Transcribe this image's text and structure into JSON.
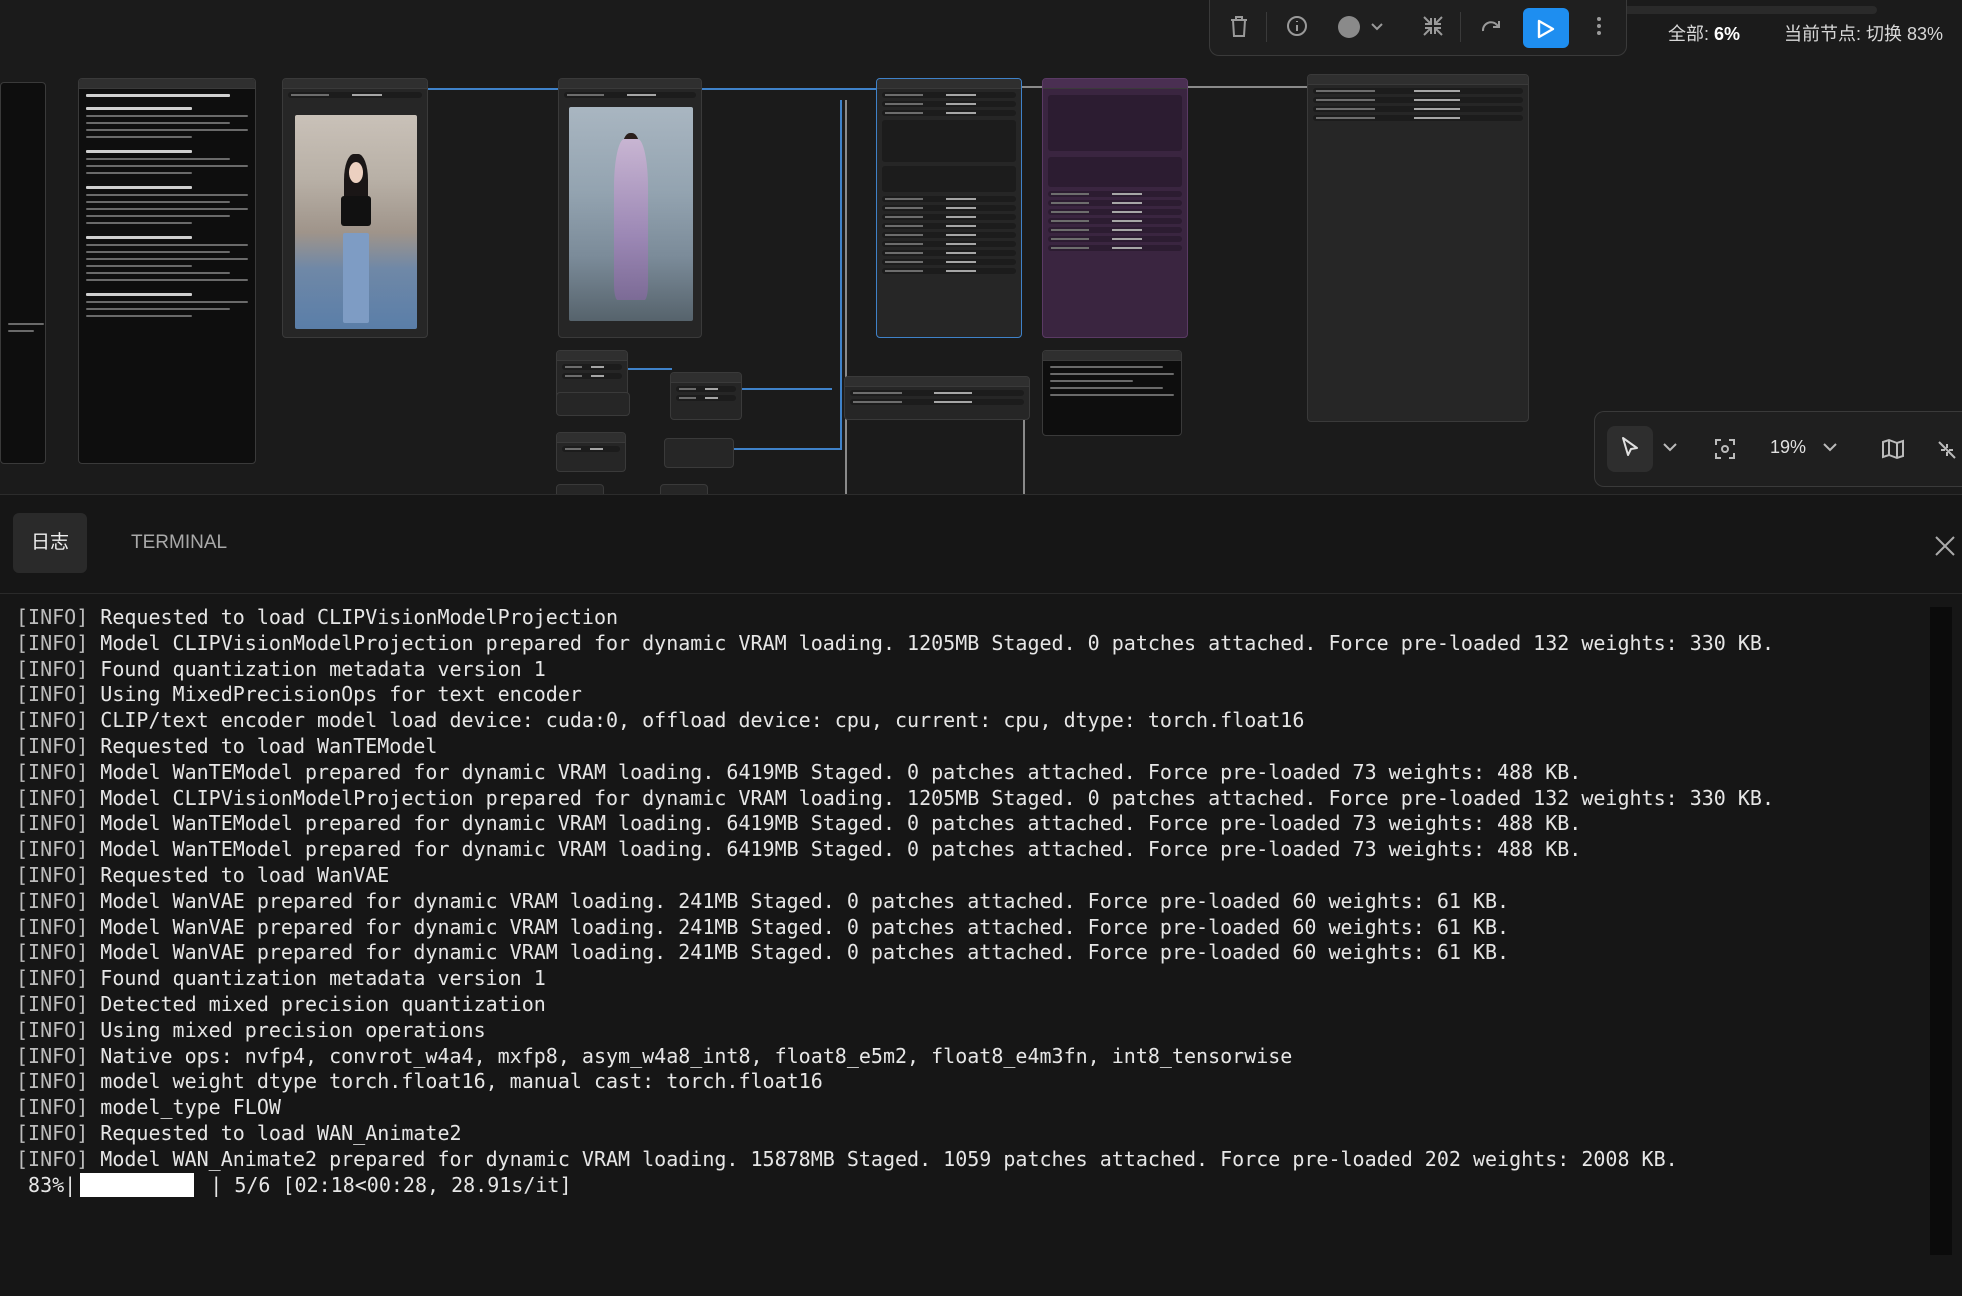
{
  "toolbar": {
    "status_total_label": "全部:",
    "status_total_value": "6%",
    "status_node_label": "当前节点:",
    "status_node_value": "切换 83%",
    "progress_percent": 6
  },
  "canvas_controls": {
    "zoom": "19%"
  },
  "panel": {
    "tabs": [
      {
        "label": "日志",
        "active": true
      },
      {
        "label": "TERMINAL",
        "active": false
      }
    ],
    "log_lines": [
      {
        "tag": "[INFO]",
        "text": " Requested to load CLIPVisionModelProjection"
      },
      {
        "tag": "[INFO]",
        "text": " Model CLIPVisionModelProjection prepared for dynamic VRAM loading. 1205MB Staged. 0 patches attached. Force pre-loaded 132 weights: 330 KB."
      },
      {
        "tag": "[INFO]",
        "text": " Found quantization metadata version 1"
      },
      {
        "tag": "[INFO]",
        "text": " Using MixedPrecisionOps for text encoder"
      },
      {
        "tag": "[INFO]",
        "text": " CLIP/text encoder model load device: cuda:0, offload device: cpu, current: cpu, dtype: torch.float16"
      },
      {
        "tag": "[INFO]",
        "text": " Requested to load WanTEModel"
      },
      {
        "tag": "[INFO]",
        "text": " Model WanTEModel prepared for dynamic VRAM loading. 6419MB Staged. 0 patches attached. Force pre-loaded 73 weights: 488 KB."
      },
      {
        "tag": "[INFO]",
        "text": " Model CLIPVisionModelProjection prepared for dynamic VRAM loading. 1205MB Staged. 0 patches attached. Force pre-loaded 132 weights: 330 KB."
      },
      {
        "tag": "[INFO]",
        "text": " Model WanTEModel prepared for dynamic VRAM loading. 6419MB Staged. 0 patches attached. Force pre-loaded 73 weights: 488 KB."
      },
      {
        "tag": "[INFO]",
        "text": " Model WanTEModel prepared for dynamic VRAM loading. 6419MB Staged. 0 patches attached. Force pre-loaded 73 weights: 488 KB."
      },
      {
        "tag": "[INFO]",
        "text": " Requested to load WanVAE"
      },
      {
        "tag": "[INFO]",
        "text": " Model WanVAE prepared for dynamic VRAM loading. 241MB Staged. 0 patches attached. Force pre-loaded 60 weights: 61 KB."
      },
      {
        "tag": "[INFO]",
        "text": " Model WanVAE prepared for dynamic VRAM loading. 241MB Staged. 0 patches attached. Force pre-loaded 60 weights: 61 KB."
      },
      {
        "tag": "[INFO]",
        "text": " Model WanVAE prepared for dynamic VRAM loading. 241MB Staged. 0 patches attached. Force pre-loaded 60 weights: 61 KB."
      },
      {
        "tag": "[INFO]",
        "text": " Found quantization metadata version 1"
      },
      {
        "tag": "[INFO]",
        "text": " Detected mixed precision quantization"
      },
      {
        "tag": "[INFO]",
        "text": " Using mixed precision operations"
      },
      {
        "tag": "[INFO]",
        "text": " Native ops: nvfp4, convrot_w4a4, mxfp8, asym_w4a8_int8, float8_e5m2, float8_e4m3fn, int8_tensorwise"
      },
      {
        "tag": "[INFO]",
        "text": " model weight dtype torch.float16, manual cast: torch.float16"
      },
      {
        "tag": "[INFO]",
        "text": " model_type FLOW"
      },
      {
        "tag": "[INFO]",
        "text": " Requested to load WAN_Animate2"
      },
      {
        "tag": "[INFO]",
        "text": " Model WAN_Animate2 prepared for dynamic VRAM loading. 15878MB Staged. 1059 patches attached. Force pre-loaded 202 weights: 2008 KB."
      }
    ],
    "progress_line": {
      "percent_text": " 83%|",
      "tail_text": " | 5/6 [02:18<00:28, 28.91s/it]",
      "fraction": 0.83
    }
  }
}
